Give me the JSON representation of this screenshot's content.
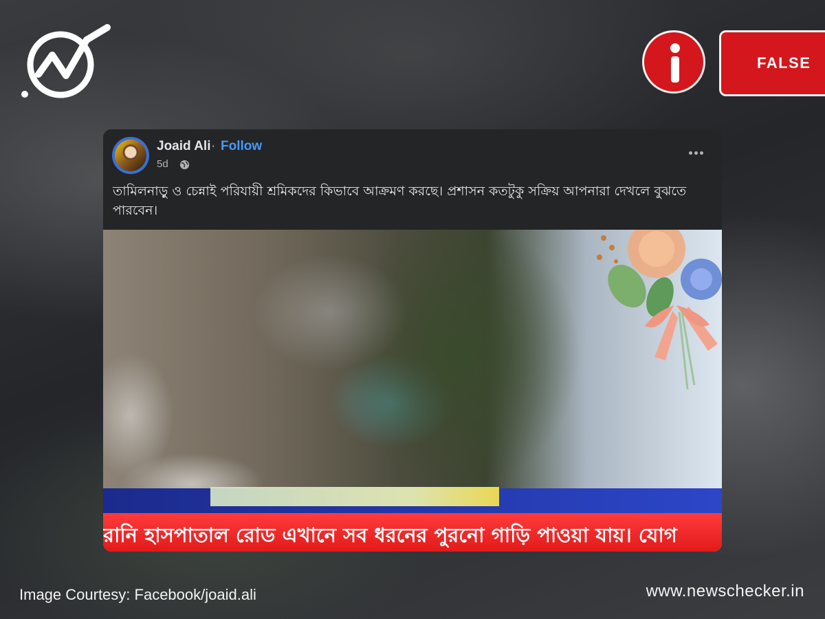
{
  "brand": {
    "icon": "newschecker-logo",
    "website": "www.newschecker.in"
  },
  "verdict": {
    "icon": "info-icon",
    "label": "FALSE",
    "color": "#d3171d"
  },
  "post": {
    "author": "Joaid Ali",
    "separator": "·",
    "follow_label": "Follow",
    "time": "5d",
    "privacy_icon": "globe-icon",
    "menu_icon": "more-options-icon",
    "caption": "তামিলনাড়ু ও চেন্নাই পরিযায়ী শ্রমিকদের কিভাবে আক্রমণ করছে। প্রশাসন কতটুকু সক্রিয় আপনারা দেখলে বুঝতে পারবেন।",
    "video": {
      "ticker_text": "রানি হাসপাতাল রোড এখানে সব ধরনের পুরনো গাড়ি পাওয়া যায়। যোগ"
    }
  },
  "footer": {
    "courtesy": "Image Courtesy: Facebook/joaid.ali"
  },
  "colors": {
    "facebook_link": "#4599ff",
    "post_background": "#242526",
    "ticker_red": "#e21a1a",
    "ticker_blue": "#2c46c8"
  }
}
